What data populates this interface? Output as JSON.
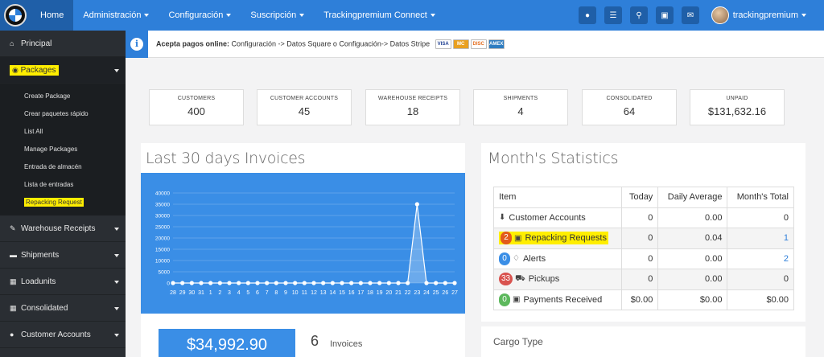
{
  "topnav": {
    "items": [
      {
        "label": "Home",
        "active": true,
        "caret": false
      },
      {
        "label": "Administración",
        "caret": true
      },
      {
        "label": "Configuración",
        "caret": true
      },
      {
        "label": "Suscripción",
        "caret": true
      },
      {
        "label": "Trackingpremium Connect",
        "caret": true
      }
    ],
    "icons": [
      "globe-icon",
      "list-icon",
      "search-icon",
      "money-icon",
      "envelope-icon"
    ],
    "user": "trackingpremium"
  },
  "sidebar": {
    "items": [
      {
        "label": "Principal",
        "icon": "home-icon"
      },
      {
        "label": "Packages",
        "icon": "tag-icon"
      },
      {
        "label": "Warehouse Receipts",
        "icon": "edit-icon"
      },
      {
        "label": "Shipments",
        "icon": "card-icon"
      },
      {
        "label": "Loadunits",
        "icon": "container-icon"
      },
      {
        "label": "Consolidated",
        "icon": "grid-icon"
      },
      {
        "label": "Customer Accounts",
        "icon": "map-marker-icon"
      }
    ],
    "packages_sub": [
      "Create Package",
      "Crear paquetes rápido",
      "List All",
      "Manage Packages",
      "Entrada de almacén",
      "Lista de entradas",
      "Repacking Request"
    ]
  },
  "notice": {
    "bold": "Acepta pagos online:",
    "text": " Configuración -> Datos Square o Configuación-> Datos Stripe",
    "cards": [
      "VISA",
      "MC",
      "DISC",
      "AMEX"
    ]
  },
  "stats": [
    {
      "label": "CUSTOMERS",
      "value": "400"
    },
    {
      "label": "CUSTOMER ACCOUNTS",
      "value": "45"
    },
    {
      "label": "WAREHOUSE RECEIPTS",
      "value": "18"
    },
    {
      "label": "SHIPMENTS",
      "value": "4"
    },
    {
      "label": "CONSOLIDATED",
      "value": "64"
    },
    {
      "label": "UNPAID",
      "value": "$131,632.16"
    }
  ],
  "invoices": {
    "title": "Last 30 days Invoices",
    "total": "$34,992.90",
    "count": "6",
    "count_label": "Invoices"
  },
  "chart_data": {
    "type": "area",
    "x": [
      "28",
      "29",
      "30",
      "31",
      "1",
      "2",
      "3",
      "4",
      "5",
      "6",
      "7",
      "8",
      "9",
      "10",
      "11",
      "12",
      "13",
      "14",
      "15",
      "16",
      "17",
      "18",
      "19",
      "20",
      "21",
      "22",
      "23",
      "24",
      "25",
      "26",
      "27"
    ],
    "values": [
      0,
      0,
      0,
      0,
      0,
      0,
      0,
      0,
      0,
      0,
      0,
      0,
      0,
      0,
      0,
      0,
      0,
      0,
      0,
      0,
      0,
      0,
      0,
      0,
      0,
      0,
      34992.9,
      0,
      0,
      0,
      0
    ],
    "ylim": [
      0,
      40000
    ],
    "yticks": [
      "0",
      "5000",
      "10000",
      "15000",
      "20000",
      "25000",
      "30000",
      "35000",
      "40000"
    ],
    "grid": true,
    "colors": {
      "background": "#3a8ee6",
      "line": "#ffffff"
    }
  },
  "month_stats": {
    "title": "Month's Statistics",
    "headers": [
      "Item",
      "Today",
      "Daily Average",
      "Month's Total"
    ],
    "rows": [
      {
        "badge": "",
        "icon": "download-icon",
        "item": "Customer Accounts",
        "today": "0",
        "avg": "0.00",
        "total": "0"
      },
      {
        "badge": "2",
        "icon": "repack-icon",
        "item": "Repacking Requests",
        "today": "0",
        "avg": "0.04",
        "total": "1"
      },
      {
        "badge": "0",
        "icon": "bell-icon",
        "item": "Alerts",
        "today": "0",
        "avg": "0.00",
        "total": "2"
      },
      {
        "badge": "33",
        "icon": "car-icon",
        "item": "Pickups",
        "today": "0",
        "avg": "0.00",
        "total": "0"
      },
      {
        "badge": "0",
        "icon": "money-icon",
        "item": "Payments Received",
        "today": "$0.00",
        "avg": "$0.00",
        "total": "$0.00"
      }
    ]
  },
  "cargo": {
    "title": "Cargo Type"
  }
}
